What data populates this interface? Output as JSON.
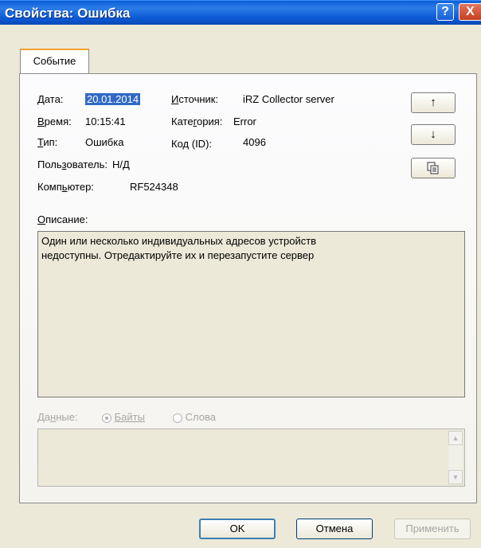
{
  "window": {
    "title": "Свойства: Ошибка",
    "help_label": "?",
    "close_label": "X"
  },
  "tabs": [
    {
      "label": "Событие"
    }
  ],
  "fields": {
    "date_label": "Дата:",
    "date_value": "20.01.2014",
    "time_label": "Время:",
    "time_value": "10:15:41",
    "type_label": "Тип:",
    "type_value": "Ошибка",
    "user_label": "Пользователь:",
    "user_value": "Н/Д",
    "computer_label": "Компьютер:",
    "computer_value": "RF524348",
    "source_label": "Источник:",
    "source_value": "iRZ Collector server",
    "category_label": "Категория:",
    "category_value": "Error",
    "id_label": "Код (ID):",
    "id_value": "4096"
  },
  "side_buttons": {
    "up_icon": "↑",
    "down_icon": "↓",
    "copy_icon": "copy-icon"
  },
  "description": {
    "label": "Описание:",
    "text_line1": "Один или несколько индивидуальных адресов устройств",
    "text_line2": "недоступны. Отредактируйте их и перезапустите сервер"
  },
  "data_section": {
    "label": "Данные:",
    "options": [
      {
        "label": "Байты",
        "selected": true
      },
      {
        "label": "Слова",
        "selected": false
      }
    ]
  },
  "buttons": {
    "ok": "OK",
    "cancel": "Отмена",
    "apply": "Применить"
  }
}
